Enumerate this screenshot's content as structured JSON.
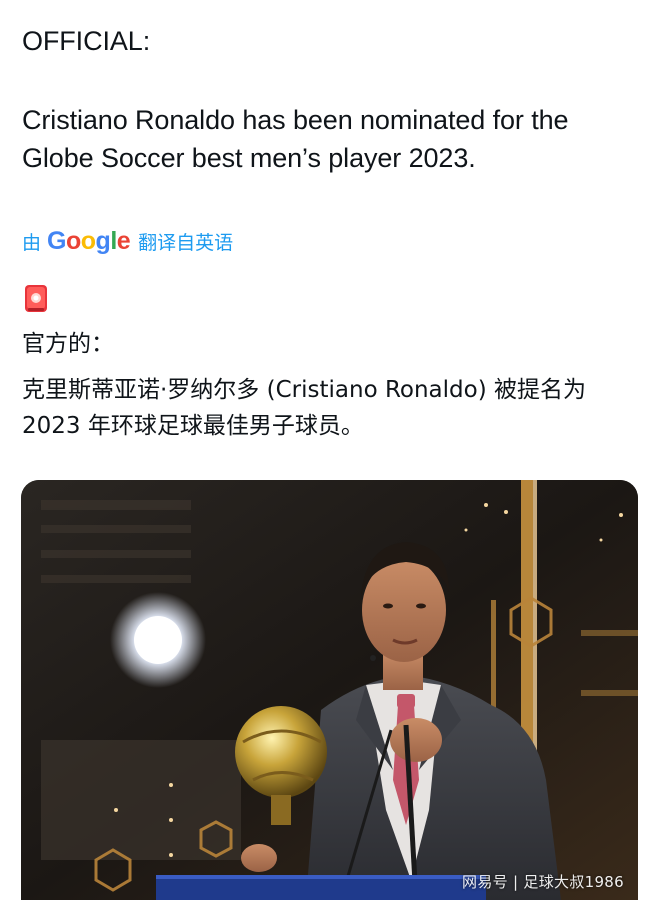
{
  "post": {
    "original_heading": "OFFICIAL:",
    "original_body": "Cristiano Ronaldo has been nominated for the Globe Soccer best men’s player 2023.",
    "translate": {
      "prefix": "由",
      "brand": "Google",
      "suffix": "翻译自英语",
      "accent_color": "#1d9bf0"
    },
    "emoji": "rotating-light-icon",
    "translated_heading": "官方的：",
    "translated_body": "克里斯蒂亚诺·罗纳尔多 (Cristiano Ronaldo) 被提名为 2023 年环球足球最佳男子球员。"
  },
  "media": {
    "type": "photo",
    "watermark": "网易号 | 足球大叔1986"
  }
}
